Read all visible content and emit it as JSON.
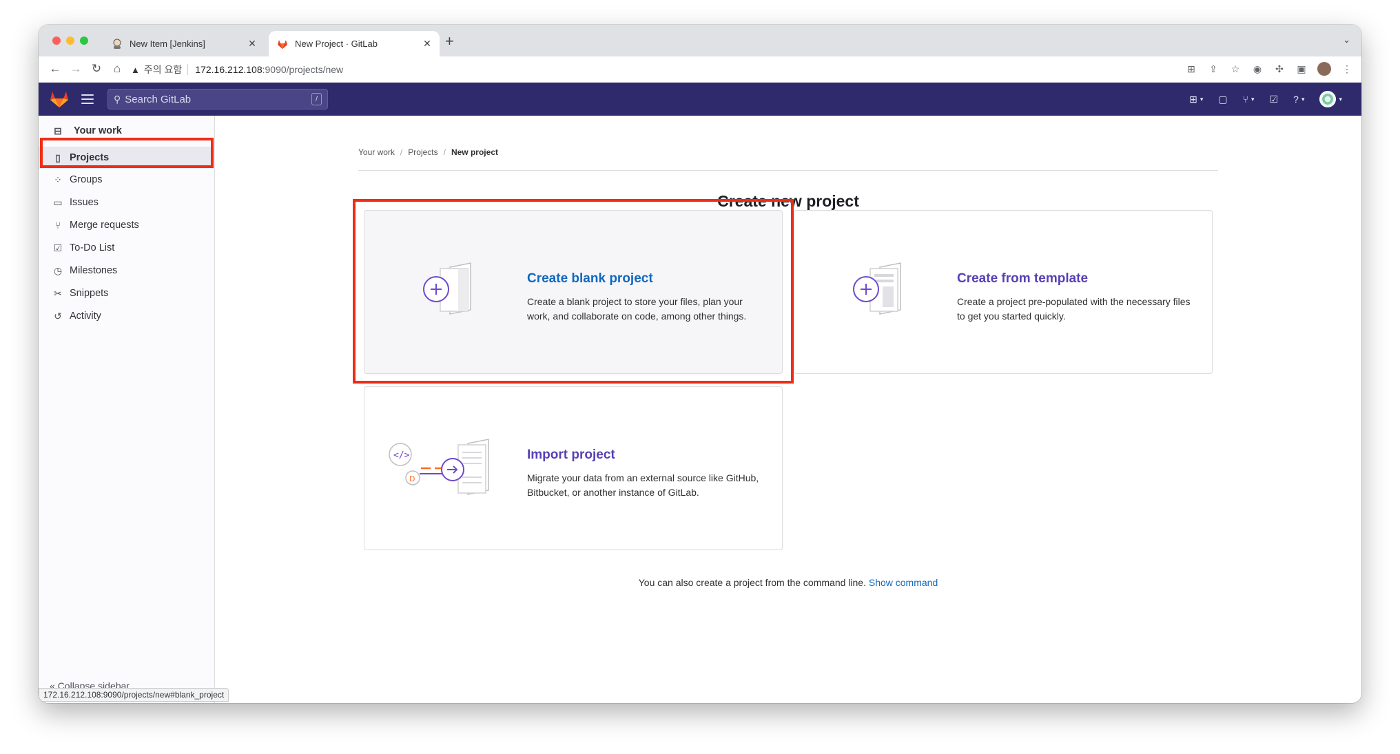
{
  "browser": {
    "tabs": [
      {
        "title": "New Item [Jenkins]",
        "active": false
      },
      {
        "title": "New Project · GitLab",
        "active": true
      }
    ],
    "new_tab_glyph": "+",
    "address": {
      "warning_label": "주의 요함",
      "url_host": "172.16.212.108",
      "url_rest": ":9090/projects/new"
    },
    "status_url": "172.16.212.108:9090/projects/new#blank_project"
  },
  "header": {
    "search_placeholder": "Search GitLab",
    "search_shortcut": "/"
  },
  "sidebar": {
    "heading": "Your work",
    "items": [
      {
        "label": "Projects",
        "icon": "project-icon",
        "active": true
      },
      {
        "label": "Groups",
        "icon": "group-icon",
        "active": false
      },
      {
        "label": "Issues",
        "icon": "issues-icon",
        "active": false
      },
      {
        "label": "Merge requests",
        "icon": "merge-request-icon",
        "active": false
      },
      {
        "label": "To-Do List",
        "icon": "todo-icon",
        "active": false
      },
      {
        "label": "Milestones",
        "icon": "clock-icon",
        "active": false
      },
      {
        "label": "Snippets",
        "icon": "snippet-icon",
        "active": false
      },
      {
        "label": "Activity",
        "icon": "history-icon",
        "active": false
      }
    ],
    "collapse_label": "Collapse sidebar"
  },
  "breadcrumb": [
    "Your work",
    "Projects",
    "New project"
  ],
  "main": {
    "title": "Create new project",
    "cards": [
      {
        "title": "Create blank project",
        "description": "Create a blank project to store your files, plan your work, and collaborate on code, among other things."
      },
      {
        "title": "Create from template",
        "description": "Create a project pre-populated with the necessary files to get you started quickly."
      },
      {
        "title": "Import project",
        "description": "Migrate your data from an external source like GitHub, Bitbucket, or another instance of GitLab."
      }
    ],
    "command_line_text": "You can also create a project from the command line.",
    "show_command": "Show command"
  },
  "colors": {
    "gitlab_header": "#2f2a6b",
    "link_blue": "#1068bf",
    "purple": "#5840b4",
    "highlight_red": "#f02d14"
  }
}
